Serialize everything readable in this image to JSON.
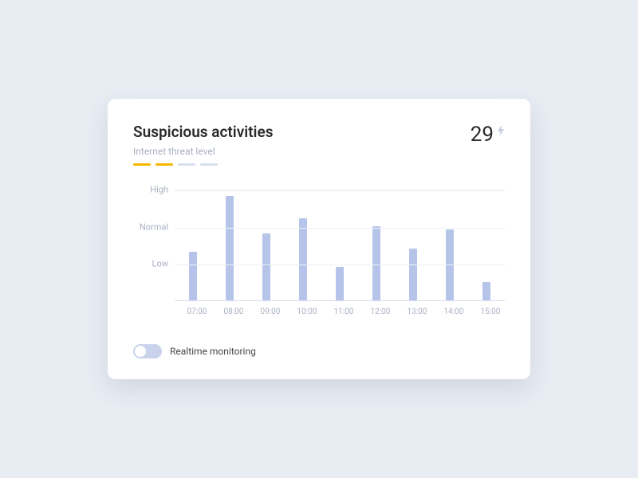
{
  "card": {
    "title": "Suspicious activities",
    "subtitle": "Internet threat level",
    "count": "29",
    "threat_level": {
      "active": 2,
      "total": 4
    }
  },
  "chart_data": {
    "type": "bar",
    "title": "Suspicious activities",
    "xlabel": "",
    "ylabel": "",
    "categories": [
      "07:00",
      "08:00",
      "09:00",
      "10:00",
      "11:00",
      "12:00",
      "13:00",
      "14:00",
      "15:00"
    ],
    "values": [
      1.3,
      2.8,
      1.8,
      2.2,
      0.9,
      2.0,
      1.4,
      1.9,
      0.5
    ],
    "y_ticks": [
      {
        "label": "High",
        "value": 3
      },
      {
        "label": "Normal",
        "value": 2
      },
      {
        "label": "Low",
        "value": 1
      }
    ],
    "ylim": [
      0,
      3
    ],
    "color": "#b5c4e8"
  },
  "toggle": {
    "label": "Realtime monitoring",
    "on": false
  }
}
